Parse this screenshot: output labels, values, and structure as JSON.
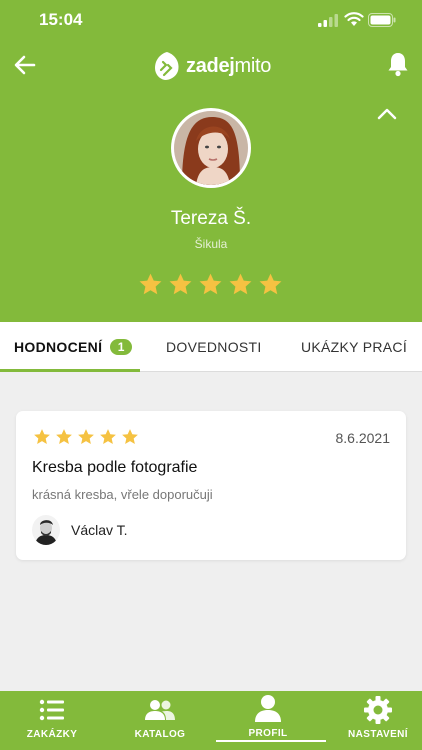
{
  "status_bar": {
    "time": "15:04"
  },
  "header": {
    "logo_text_bold": "zadej",
    "logo_text_light": "mito",
    "user_name": "Tereza Š.",
    "user_role": "Šikula",
    "rating_stars": 5,
    "brand_color": "#83ba3b",
    "star_color": "#f5c242"
  },
  "tabs": [
    {
      "label": "HODNOCENÍ",
      "badge": "1",
      "active": true
    },
    {
      "label": "DOVEDNOSTI",
      "active": false
    },
    {
      "label": "UKÁZKY PRACÍ",
      "active": false
    }
  ],
  "review": {
    "stars": 5,
    "date": "8.6.2021",
    "title": "Kresba podle fotografie",
    "text": "krásná kresba, vřele doporučuji",
    "author": "Václav T."
  },
  "bottom_nav": [
    {
      "label": "ZAKÁZKY",
      "icon": "list-icon"
    },
    {
      "label": "KATALOG",
      "icon": "people-icon"
    },
    {
      "label": "PROFIL",
      "icon": "person-icon",
      "active": true
    },
    {
      "label": "NASTAVENÍ",
      "icon": "gear-icon"
    }
  ]
}
